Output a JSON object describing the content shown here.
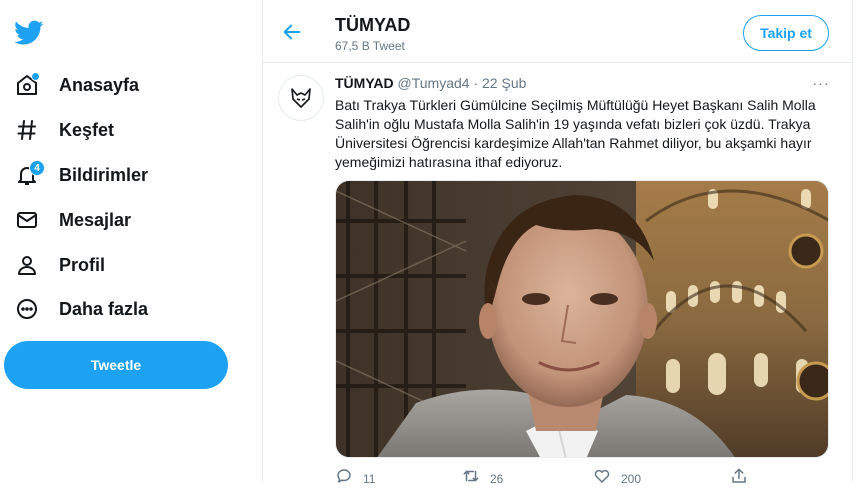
{
  "nav": {
    "items": [
      {
        "label": "Anasayfa",
        "icon": "home-icon"
      },
      {
        "label": "Keşfet",
        "icon": "hashtag-icon"
      },
      {
        "label": "Bildirimler",
        "icon": "bell-icon",
        "badge": "4"
      },
      {
        "label": "Mesajlar",
        "icon": "envelope-icon"
      },
      {
        "label": "Profil",
        "icon": "person-icon"
      },
      {
        "label": "Daha fazla",
        "icon": "more-circle-icon"
      }
    ],
    "tweet_button": "Tweetle"
  },
  "header": {
    "title": "TÜMYAD",
    "subtitle": "67,5 B Tweet",
    "follow_label": "Takip et"
  },
  "tweet": {
    "name": "TÜMYAD",
    "handle": "@Tumyad4",
    "separator": "·",
    "date": "22 Şub",
    "more": "···",
    "text": "Batı Trakya Türkleri Gümülcine Seçilmiş Müftülüğü Heyet Başkanı Salih Molla Salih'in oğlu Mustafa Molla Salih'in 19 yaşında vefatı bizleri çok üzdü. Trakya Üniversitesi Öğrencisi kardeşimize Allah'tan Rahmet diliyor, bu akşamki hayır yemeğimizi hatırasına ithaf ediyoruz.",
    "actions": {
      "reply_count": "11",
      "retweet_count": "26",
      "like_count": "200"
    }
  },
  "colors": {
    "accent": "#1da1f2",
    "text": "#14171a",
    "muted": "#657786",
    "border": "#e6ecf0"
  }
}
